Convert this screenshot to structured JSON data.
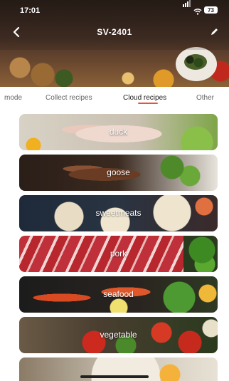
{
  "status_bar": {
    "time": "17:01",
    "battery": "73"
  },
  "header": {
    "title": "SV-2401"
  },
  "tabs": [
    {
      "label": "mode",
      "active": false
    },
    {
      "label": "Collect recipes",
      "active": false
    },
    {
      "label": "Cloud recipes",
      "active": true
    },
    {
      "label": "Other",
      "active": false
    }
  ],
  "categories": [
    {
      "label": "duck"
    },
    {
      "label": "goose"
    },
    {
      "label": "sweetmeats"
    },
    {
      "label": "pork"
    },
    {
      "label": "seafood"
    },
    {
      "label": "vegetable"
    }
  ],
  "colors": {
    "accent": "#e8533a"
  },
  "icons": {
    "back": "chevron-left-icon",
    "edit": "pencil-icon"
  }
}
